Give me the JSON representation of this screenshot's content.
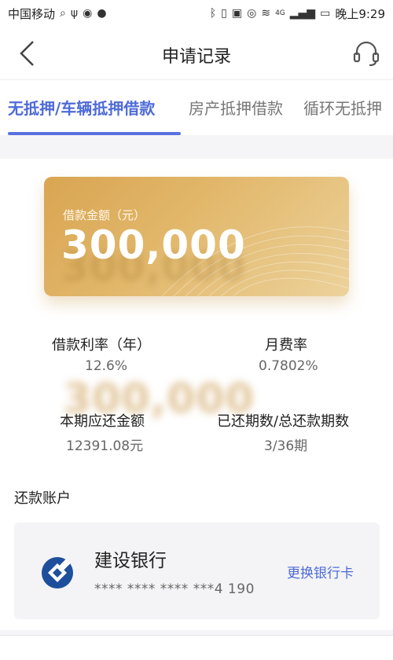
{
  "status_bar": {
    "carrier": "中国移动",
    "time": "晚上9:29",
    "network": "4G"
  },
  "nav": {
    "title": "申请记录"
  },
  "tabs": [
    {
      "label": "无抵押/车辆抵押借款",
      "active": true
    },
    {
      "label": "房产抵押借款",
      "active": false
    },
    {
      "label": "循环无抵押",
      "active": false
    }
  ],
  "loan_card": {
    "amount_label": "借款金额（元）",
    "amount": "300,000"
  },
  "details": {
    "rate_label": "借款利率（年）",
    "rate_value": "12.6%",
    "fee_label": "月费率",
    "fee_value": "0.7802%",
    "due_label": "本期应还金额",
    "due_value": "12391.08元",
    "period_label": "已还期数/总还款期数",
    "period_value": "3/36期"
  },
  "repay_account": {
    "section_title": "还款账户",
    "bank_name": "建设银行",
    "card_number": "**** **** **** ***4 190",
    "change_label": "更换银行卡"
  },
  "colors": {
    "accent": "#4f6bd8",
    "card_gold": "#e2b86c"
  }
}
